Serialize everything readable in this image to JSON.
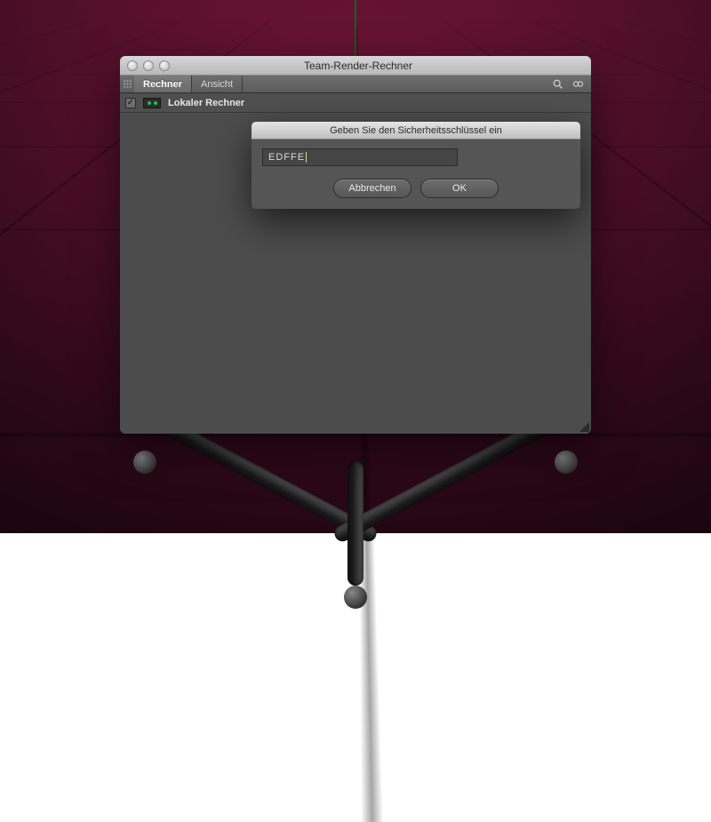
{
  "window": {
    "title": "Team-Render-Rechner",
    "tabs": [
      "Rechner",
      "Ansicht"
    ],
    "active_tab": 0,
    "row": {
      "label": "Lokaler Rechner",
      "checked": true
    }
  },
  "modal": {
    "title": "Geben Sie den Sicherheitsschlüssel ein",
    "value": "EDFFE",
    "cancel": "Abbrechen",
    "ok": "OK"
  }
}
